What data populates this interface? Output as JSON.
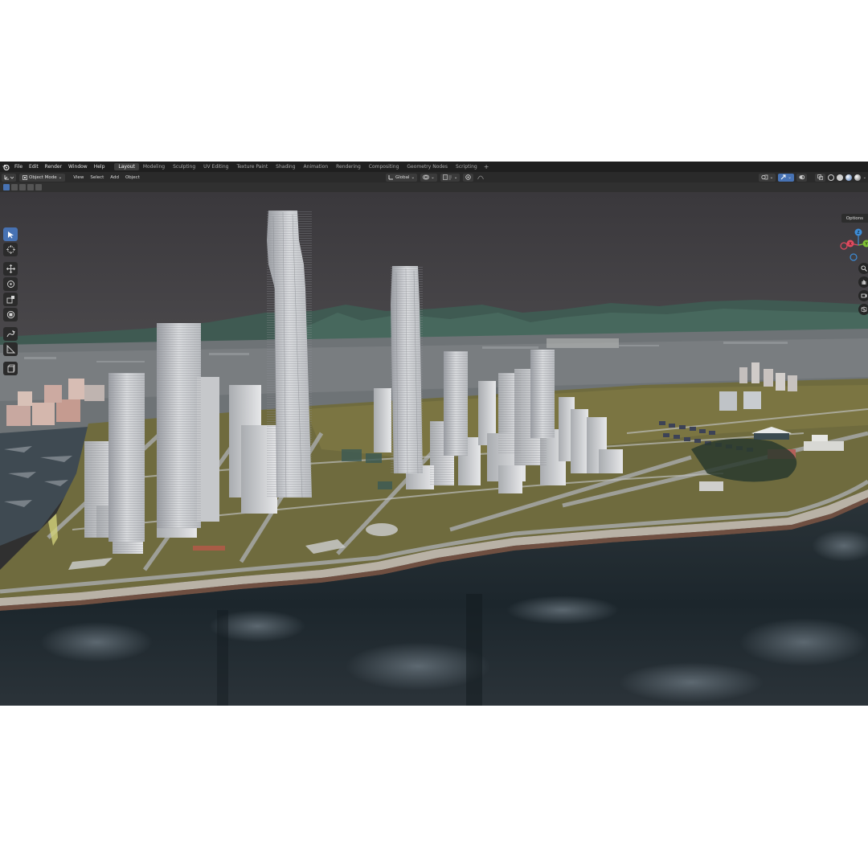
{
  "topbar": {
    "menu": [
      "File",
      "Edit",
      "Render",
      "Window",
      "Help"
    ],
    "workspaces": [
      "Layout",
      "Modeling",
      "Sculpting",
      "UV Editing",
      "Texture Paint",
      "Shading",
      "Animation",
      "Rendering",
      "Compositing",
      "Geometry Nodes",
      "Scripting"
    ],
    "active_workspace": "Layout",
    "add_label": "+"
  },
  "header": {
    "mode_label": "Object Mode",
    "menu": [
      "View",
      "Select",
      "Add",
      "Object"
    ],
    "transform_orientation": "Global"
  },
  "viewport": {
    "options_label": "Options",
    "gizmo_axes": [
      "X",
      "Y",
      "Z"
    ]
  },
  "colors": {
    "accent": "#4772b3",
    "axis_x": "#e04a5f",
    "axis_y": "#7fbf34",
    "axis_z": "#3d8cd6",
    "background": "#303030",
    "sky": "#3c3a3e",
    "water": "#1f2a31"
  },
  "tools": [
    "select-box-icon",
    "cursor-icon",
    "move-icon",
    "rotate-icon",
    "scale-icon",
    "transform-icon",
    "annotate-icon",
    "measure-icon",
    "add-cube-icon"
  ]
}
